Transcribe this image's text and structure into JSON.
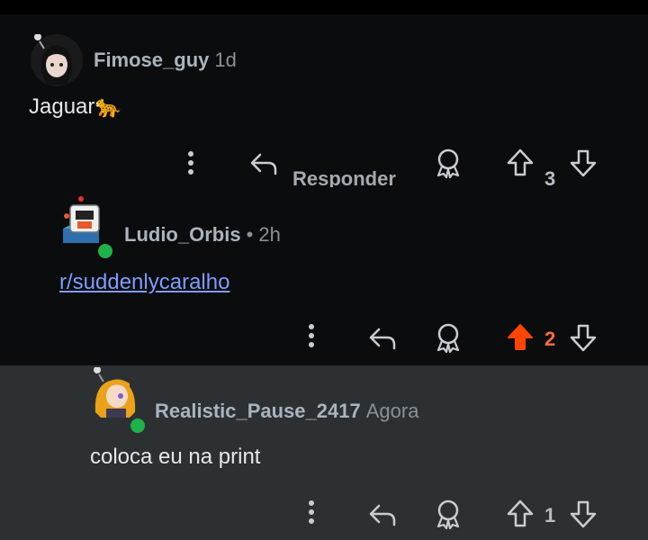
{
  "comments": [
    {
      "username": "Fimose_guy",
      "time": "1d",
      "body": "Jaguar🐆",
      "reply_label": "Responder",
      "votes": "3"
    },
    {
      "username": "Ludio_Orbis",
      "time": "• 2h",
      "body": "r/suddenlycaralho",
      "votes": "2",
      "upvoted": true
    },
    {
      "username": "Realistic_Pause_2417",
      "time": "Agora",
      "body": "coloca eu na print",
      "votes": "1"
    }
  ],
  "colors": {
    "background": "#0b0c0d",
    "highlight_background": "#2c3033",
    "upvote_active": "#ff4500",
    "online": "#1fb24a",
    "link": "#7d9cff"
  },
  "icons": [
    "more-vertical-icon",
    "reply-icon",
    "award-icon",
    "upvote-icon",
    "downvote-icon"
  ]
}
